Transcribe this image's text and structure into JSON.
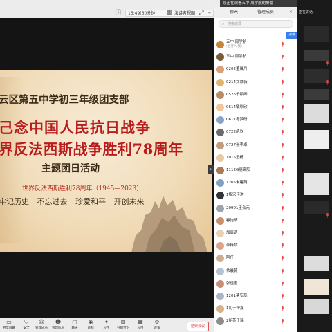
{
  "topbar": {
    "status_text": "15:49(60分钟)",
    "speaker_view_label": "演讲者视图",
    "share_notice": "您正在观看五中 周学航的屏幕"
  },
  "slide": {
    "org": "云区第五中学初三年级团支部",
    "title_line1": "己念中国人民抗日战争",
    "title_line2": "界反法西斯战争胜利78周年",
    "subtitle": "主题团日活动",
    "anniversary": "世界反法西斯胜利78周年（1945—2023）",
    "slogan": "牢记历史   不忘过去   珍爱和平   开创未来"
  },
  "toolbar": {
    "items": [
      {
        "label": "共享屏幕",
        "icon": "share-screen-icon"
      },
      {
        "label": "安全",
        "icon": "shield-icon"
      },
      {
        "label": "管理成员",
        "icon": "manage-members-icon"
      },
      {
        "label": "管理成员",
        "icon": "members-icon"
      },
      {
        "label": "聊天",
        "icon": "chat-icon"
      },
      {
        "label": "录制",
        "icon": "record-icon"
      },
      {
        "label": "应用",
        "icon": "apps-icon"
      },
      {
        "label": "分组讨论",
        "icon": "breakout-icon"
      },
      {
        "label": "应用",
        "icon": "apps-grid-icon"
      },
      {
        "label": "设置",
        "icon": "gear-icon"
      }
    ],
    "end_label": "结束会议"
  },
  "panel": {
    "tab_chat": "聊天",
    "tab_members": "管理成员",
    "search_placeholder": "搜索成员",
    "side_button": "邀请",
    "participants": [
      {
        "name": "五中 周学航",
        "role": "(主持人,我)",
        "color": "#c8843c"
      },
      {
        "name": "五中 周学航",
        "role": "",
        "color": "#7a5c3a"
      },
      {
        "name": "0202董晨丹",
        "role": "",
        "color": "#d9a07a"
      },
      {
        "name": "0214文慕薇",
        "role": "",
        "color": "#e2b36f"
      },
      {
        "name": "0526子颖卿",
        "role": "",
        "color": "#b88d68"
      },
      {
        "name": "0614敏欣欣",
        "role": "",
        "color": "#f0c69b"
      },
      {
        "name": "0617冬梦研",
        "role": "",
        "color": "#8aa4c8"
      },
      {
        "name": "0722函欣",
        "role": "",
        "color": "#6b6b6b"
      },
      {
        "name": "0727张李卓",
        "role": "",
        "color": "#c39b7d"
      },
      {
        "name": "1015王畅",
        "role": "",
        "color": "#e8c9a3"
      },
      {
        "name": "1112G丽高阳",
        "role": "",
        "color": "#a87b56"
      },
      {
        "name": "1205朱建苑",
        "role": "",
        "color": "#7fa0c4"
      },
      {
        "name": "1埃宋佳琪",
        "role": "",
        "color": "#333333"
      },
      {
        "name": "20901王会元",
        "role": "",
        "color": "#9aa4ad"
      },
      {
        "name": "春怡晴",
        "role": "",
        "color": "#c98e6a"
      },
      {
        "name": "加辰语",
        "role": "",
        "color": "#e6d2b5"
      },
      {
        "name": "李梓娇",
        "role": "",
        "color": "#dba48c"
      },
      {
        "name": "阿任一",
        "role": "",
        "color": "#cfae8f"
      },
      {
        "name": "依晨薇",
        "role": "",
        "color": "#b6c2cf"
      },
      {
        "name": "张佳惠",
        "role": "",
        "color": "#c88f76"
      },
      {
        "name": "1201蔡安蕊",
        "role": "",
        "color": "#a8b7c6"
      },
      {
        "name": "1初于博鑫",
        "role": "",
        "color": "#d4b28e"
      },
      {
        "name": "2朔荟王瑞",
        "role": "",
        "color": "#8d8d8d"
      }
    ]
  },
  "video_column": {
    "status_text": "正在讲话:"
  },
  "colors": {
    "accent": "#3b7ee8",
    "slide_red": "#b81b1b",
    "end_red": "#d33333"
  }
}
